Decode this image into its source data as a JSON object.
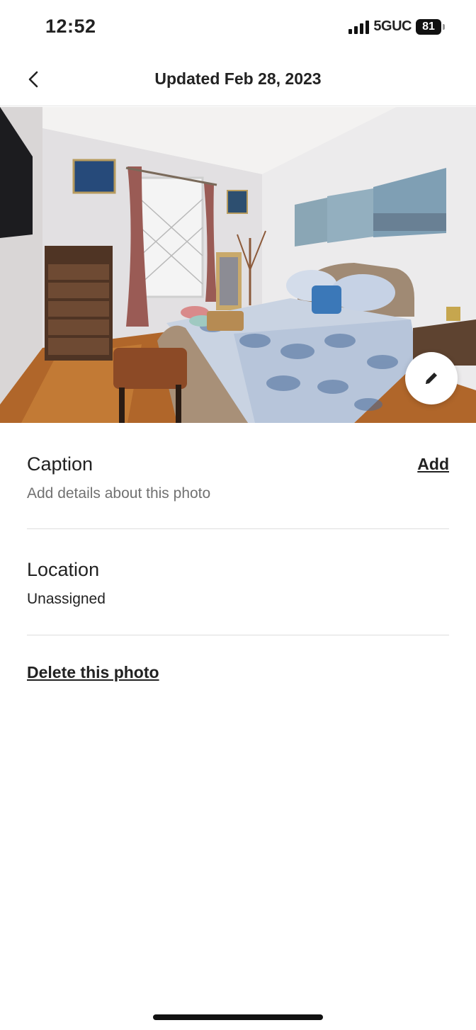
{
  "status_bar": {
    "time": "12:52",
    "network": "5GUC",
    "battery": "81"
  },
  "header": {
    "title": "Updated Feb 28, 2023",
    "back_icon": "chevron-left-icon"
  },
  "photo": {
    "alt": "Bedroom with bed, dresser, bench and window",
    "edit_icon": "pencil-icon"
  },
  "caption": {
    "title": "Caption",
    "placeholder": "Add details about this photo",
    "action_label": "Add"
  },
  "location": {
    "title": "Location",
    "value": "Unassigned"
  },
  "delete_label": "Delete this photo"
}
